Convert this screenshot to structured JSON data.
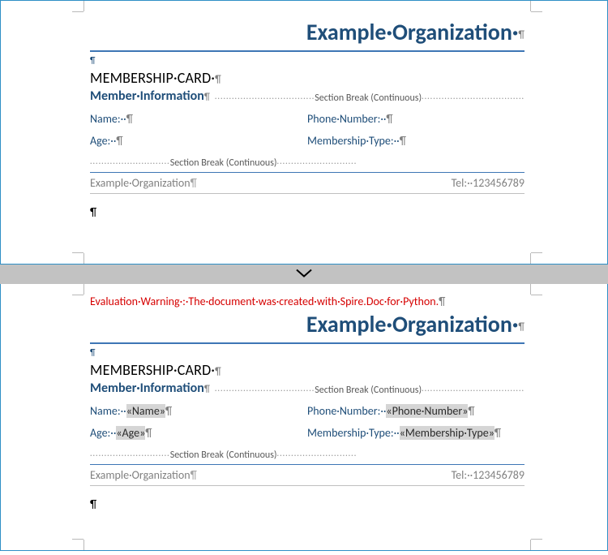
{
  "colors": {
    "page_border": "#2e8fc6",
    "accent_blue": "#1f4e79",
    "line_blue": "#3e76b5",
    "gap_gray": "#c2c2c2",
    "warn_red": "#d60000"
  },
  "glyphs": {
    "pilcrow": "¶",
    "midline_chevron": "❯"
  },
  "card": {
    "org_title": "Example·Organization·",
    "heading": "MEMBERSHIP·CARD·",
    "section": "Member·Information",
    "secbreak": "Section Break (Continuous)",
    "labels": {
      "name": "Name:··",
      "age": "Age:··",
      "phone": "Phone·Number:··",
      "mtype": "Membership·Type:··"
    },
    "footer_left": "Example·Organization",
    "footer_right": "Tel:··123456789"
  },
  "page2": {
    "warning": "Evaluation·Warning·:·The·document·was·created·with·Spire.Doc·for·Python.",
    "merge": {
      "name": "«Name»",
      "age": "«Age»",
      "phone": "«Phone·Number»",
      "mtype": "«Membership·Type»"
    }
  }
}
